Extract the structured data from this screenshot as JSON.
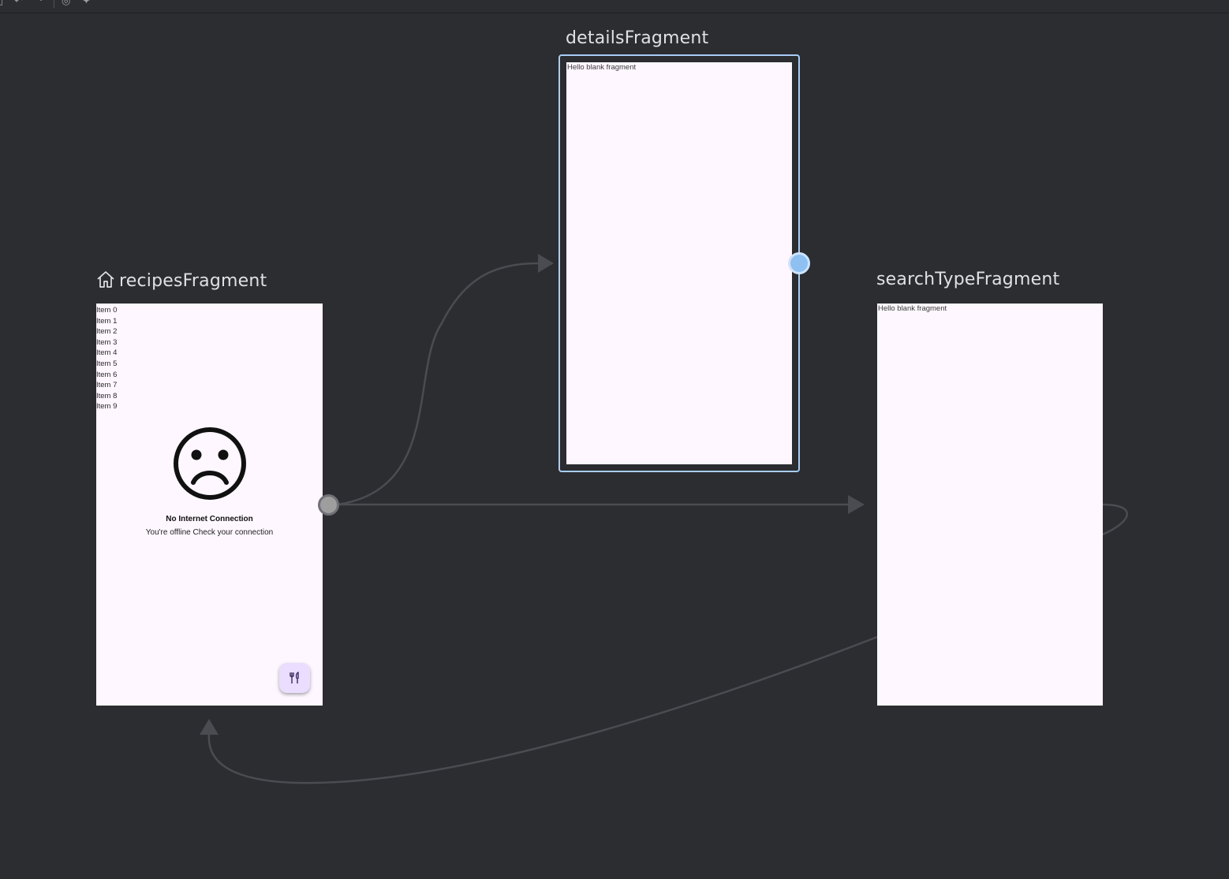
{
  "toolbar": {
    "icons": [
      "panel-icon",
      "undo-icon",
      "redo-icon",
      "link-icon",
      "auto-arrange-icon"
    ]
  },
  "colors": {
    "canvas_background": "#2b2d30",
    "screen_background": "#fef7ff",
    "selection": "#a8cdf8",
    "edge": "#4a4c52",
    "action_handle": "#9e9e9e",
    "fab_background": "#eaddff"
  },
  "destinations": {
    "recipes": {
      "title": "recipesFragment",
      "is_start_destination": true,
      "items": [
        "Item 0",
        "Item 1",
        "Item 2",
        "Item 3",
        "Item 4",
        "Item 5",
        "Item 6",
        "Item 7",
        "Item 8",
        "Item 9"
      ],
      "error_title": "No Internet Connection",
      "error_subtitle": "You're offline Check your connection",
      "fab_icon": "restaurant-icon"
    },
    "details": {
      "title": "detailsFragment",
      "selected": true,
      "text": "Hello blank fragment"
    },
    "search_type": {
      "title": "searchTypeFragment",
      "text": "Hello blank fragment"
    }
  },
  "actions": [
    {
      "from": "recipesFragment",
      "to": "detailsFragment"
    },
    {
      "from": "recipesFragment",
      "to": "searchTypeFragment"
    },
    {
      "from": "searchTypeFragment",
      "to": "recipesFragment"
    },
    {
      "from": "searchTypeFragment",
      "to": "searchTypeFragment"
    }
  ]
}
